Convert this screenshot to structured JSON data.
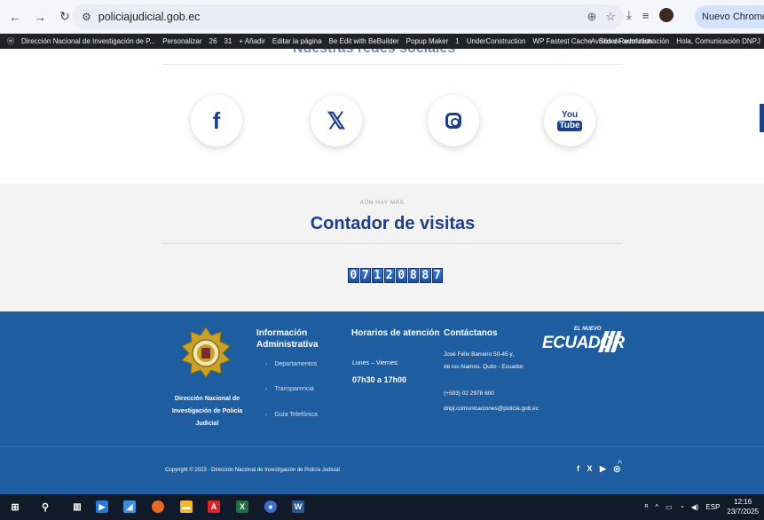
{
  "browser": {
    "url": "policiajudicial.gob.ec",
    "update_label": "Nuevo Chrome disponible"
  },
  "wp_admin_bar": {
    "left_items": [
      "Dirección Nacional de Investigación de P...",
      "Personalizar",
      "26",
      "31",
      "+ Añadir",
      "Editar la página",
      "Be Edit with BeBuilder",
      "Popup Maker",
      "UnderConstruction",
      "WP Fastest Cache",
      "Slider Revolution"
    ],
    "popup_count": "1",
    "right_items": [
      "Avisos de administración",
      "Hola, Comunicación DNPJ"
    ]
  },
  "social_section": {
    "partial_title": "Nuestras redes sociales",
    "icons": [
      "facebook-icon",
      "x-twitter-icon",
      "instagram-icon",
      "youtube-icon"
    ],
    "youtube_you": "You",
    "youtube_tube": "Tube"
  },
  "counter_section": {
    "kicker": "AÚN HAY MÁS",
    "title": "Contador de visitas",
    "digits": [
      "0",
      "7",
      "1",
      "2",
      "0",
      "8",
      "8",
      "7"
    ]
  },
  "footer": {
    "org_name": "Dirección Nacional de Investigación de Policía Judicial",
    "info_title": "Información Administrativa",
    "info_links": [
      "Departamentos",
      "Transparencia",
      "Guía Telefónica"
    ],
    "hours_title": "Horarios de atención",
    "hours_days": "Lunes – Viernes:",
    "hours_time": "07h30 a 17h00",
    "contact_title": "Contáctanos",
    "contact_address_1": "José Félix Barreiro 50-45 y,",
    "contact_address_2": "de los Alamos. Quito - Ecuador.",
    "contact_phone": "(+593) 02 2978 800",
    "contact_email": "dnpj.comunicaciones@policia.gob.ec",
    "brand_small": "EL NUEVO",
    "brand_big": "ECUADOR",
    "copyright": "Copyright © 2023 - Dirección Nacional de Investigación de Policía Judicial",
    "social_glyphs": "f X ▶ ◎"
  },
  "taskbar": {
    "time": "12:16",
    "date": "23/7/2025",
    "lang": "ESP"
  }
}
